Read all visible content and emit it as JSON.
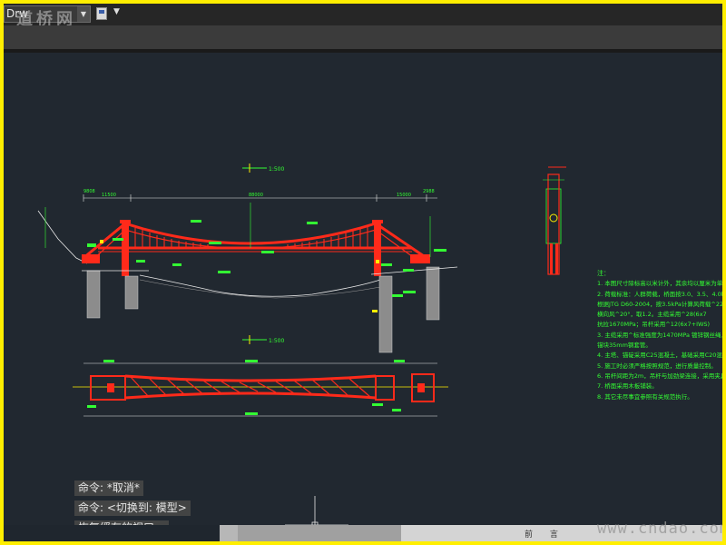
{
  "toolbar": {
    "workspace_value": "Drw",
    "watermark": "道桥网",
    "icons": [
      "save-icon",
      "dropdown-arrow-icon"
    ]
  },
  "drawing": {
    "elevation_scale": "1:500",
    "plan_scale": "1:500",
    "dims": {
      "left_span": "11500",
      "main_span": "88000",
      "right_span": "15000",
      "left_end": "9808",
      "right_end": "2988"
    }
  },
  "notes": {
    "title": "注：",
    "lines": [
      "1. 本图尺寸除标高以米计外，其余均以厘米为单位。",
      "2. 荷载标准：人群荷载，桥面按3.0、3.5、4.0kN/",
      "   根据JTG D60-2004，按3.5kPa计算风荷载^22",
      "   横向风^20°，取1.2。主缆采用^28(6x7",
      "   抗拉1670MPa；吊杆采用^12(6x7+IWS)",
      "3. 主缆采用^标准强度为1470MPa 镀锌钢丝绳，",
      "   锚块35mm钢套管。",
      "4. 主塔、锚碇采用C25混凝土，基础采用C20混凝土。",
      "5. 施工时必须严格按照规范，进行质量控制。",
      "6. 吊杆间距为2m，吊杆与加劲梁连接，采用夹具连接。",
      "7. 桥面采用木板铺装。",
      "8. 其它未尽事宜参照有关规范执行。"
    ]
  },
  "command": {
    "lines": [
      "命令: *取消*",
      "命令:   <切换到: 模型>",
      "恢复缓存的视口。"
    ]
  },
  "status": {
    "label": "前 言",
    "watermark": "www.cndao.com"
  },
  "colors": {
    "border": "#ffee00",
    "canvas": "#212830",
    "bridge": "#ff2a1a",
    "dims": "#33ff33",
    "outline": "#e8e8e8"
  }
}
